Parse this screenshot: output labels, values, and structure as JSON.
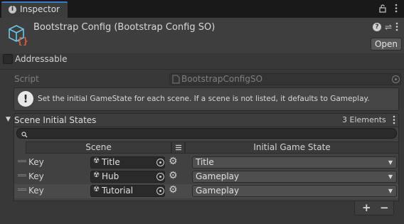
{
  "window": {
    "tab_label": "Inspector",
    "tab_icon": "info-icon"
  },
  "header": {
    "title": "Bootstrap Config (Bootstrap Config SO)",
    "open_label": "Open",
    "icons": [
      "help-icon",
      "preset-icon",
      "kebab-menu-icon"
    ]
  },
  "addressable": {
    "label": "Addressable",
    "checked": false
  },
  "script_field": {
    "label": "Script",
    "value": "BootstrapConfigSO"
  },
  "help_box": {
    "text": "Set the initial GameState for each scene. If a scene is not listed, it defaults to Gameplay."
  },
  "list": {
    "title": "Scene Initial States",
    "count_label": "3 Elements",
    "search_placeholder": "",
    "columns": {
      "scene": "Scene",
      "state": "Initial Game State"
    },
    "rows": [
      {
        "key_label": "Key",
        "scene": "Title",
        "state": "Title"
      },
      {
        "key_label": "Key",
        "scene": "Hub",
        "state": "Gameplay"
      },
      {
        "key_label": "Key",
        "scene": "Tutorial",
        "state": "Gameplay"
      }
    ],
    "add_label": "+",
    "remove_label": "−"
  },
  "colors": {
    "accent": "#3a79bb",
    "scriptable_object_icon": "#6ec6e6",
    "scriptable_object_braces": "#e05c3a"
  }
}
